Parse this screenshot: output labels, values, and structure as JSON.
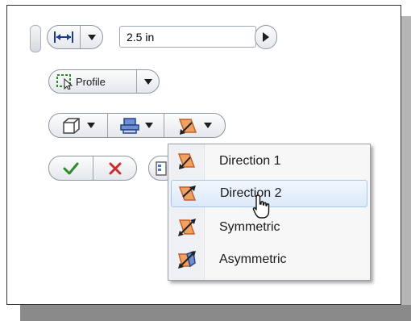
{
  "distance": {
    "value": "2.5 in",
    "method_icon": "dimension-arrows-icon"
  },
  "profile": {
    "label": "Profile"
  },
  "toolbar": {
    "output_icon": "solid-cube-icon",
    "operation_icon": "join-operation-icon",
    "direction_icon": "direction-arrow-icon"
  },
  "actions": {
    "ok_icon": "checkmark-icon",
    "cancel_icon": "cancel-x-icon"
  },
  "direction_menu": {
    "items": [
      {
        "label": "Direction 1",
        "icon": "direction-1-icon",
        "highlighted": false
      },
      {
        "label": "Direction 2",
        "icon": "direction-2-icon",
        "highlighted": true
      },
      {
        "label": "Symmetric",
        "icon": "symmetric-icon",
        "highlighted": false
      },
      {
        "label": "Asymmetric",
        "icon": "asymmetric-icon",
        "highlighted": false
      }
    ]
  },
  "colors": {
    "accent_orange": "#e8843a",
    "ok_green": "#2f8a2f",
    "cancel_red": "#d22a2a",
    "hover_blue": "#dce9f9"
  }
}
